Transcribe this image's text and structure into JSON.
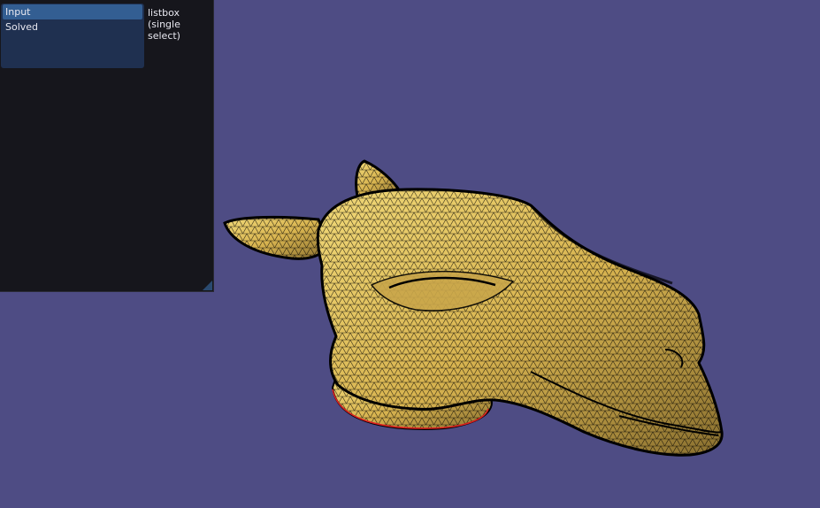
{
  "listbox": {
    "items": [
      {
        "label": "Input",
        "selected": true
      },
      {
        "label": "Solved",
        "selected": false
      }
    ],
    "label_line1": "listbox",
    "label_line2": "(single select)"
  },
  "colors": {
    "viewport_background": "#4e4c84",
    "panel_background": "#16161c",
    "listbox_background": "#1f3050",
    "selected_item": "#335e92",
    "mesh_fill": "#e6c45e",
    "mesh_wire": "#000000",
    "boundary_edge": "#e02020"
  },
  "icons": {
    "resize_grip": "resize-grip-icon"
  }
}
